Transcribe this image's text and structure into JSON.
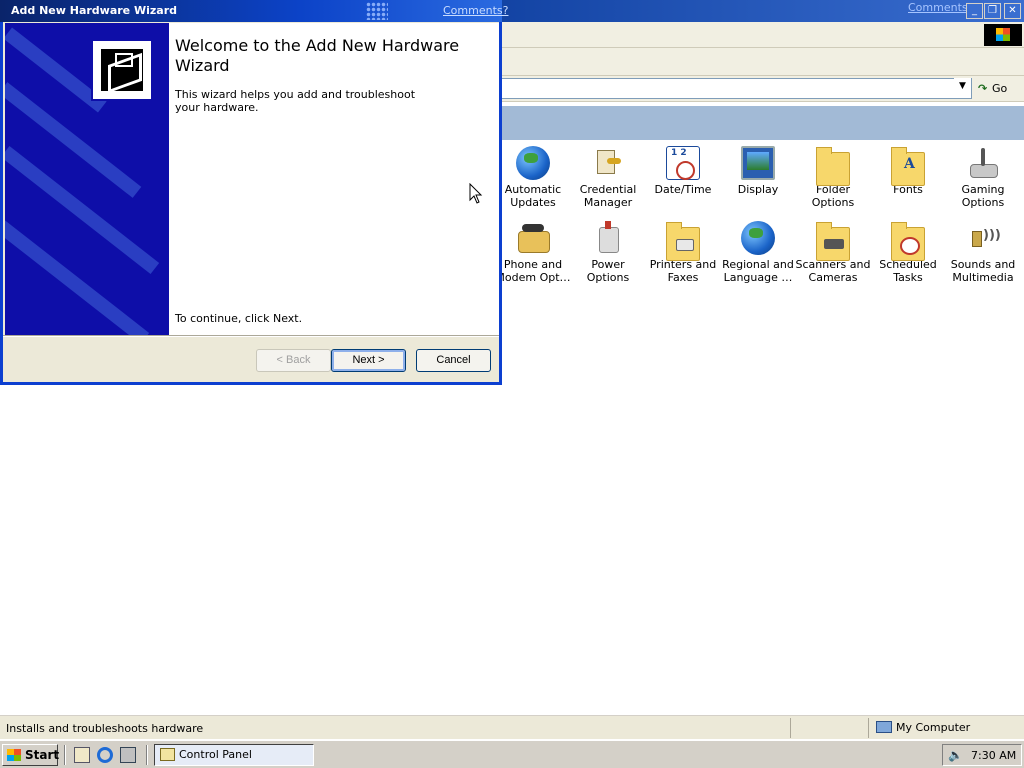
{
  "control_panel": {
    "title_link": "Comments?",
    "go_label": "Go",
    "icons": [
      {
        "label": "Automatic Updates"
      },
      {
        "label": "Credential Manager"
      },
      {
        "label": "Date/Time"
      },
      {
        "label": "Display"
      },
      {
        "label": "Folder Options"
      },
      {
        "label": "Fonts"
      },
      {
        "label": "Gaming Options"
      },
      {
        "label": "Phone and Modem Opt…"
      },
      {
        "label": "Power Options"
      },
      {
        "label": "Printers and Faxes"
      },
      {
        "label": "Regional and Language …"
      },
      {
        "label": "Scanners and Cameras"
      },
      {
        "label": "Scheduled Tasks"
      },
      {
        "label": "Sounds and Multimedia"
      }
    ]
  },
  "wizard": {
    "title": "Add New Hardware Wizard",
    "comments_link": "Comments?",
    "heading": "Welcome to the Add New Hardware Wizard",
    "description": "This wizard helps you add and troubleshoot your hardware.",
    "continue_text": "To continue, click Next.",
    "back_label": "< Back",
    "next_label": "Next >",
    "cancel_label": "Cancel",
    "back_enabled": false
  },
  "statusbar": {
    "text": "Installs and troubleshoots hardware",
    "zone": "My Computer"
  },
  "taskbar": {
    "start_label": "Start",
    "task_label": "Control Panel",
    "clock": "7:30 AM"
  },
  "colors": {
    "title_bar": "#0a246a",
    "wizard_banner": "#0e0ea8",
    "header_band": "#a2bad6",
    "taskbar": "#d4d0c8"
  }
}
